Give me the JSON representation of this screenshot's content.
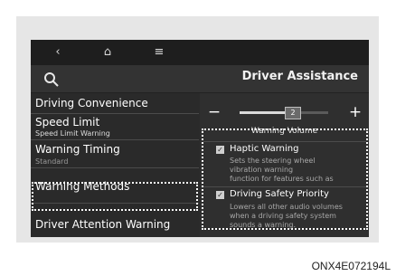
{
  "nav": {
    "back_icon": "‹",
    "home_icon": "⌂",
    "menu_icon": "≡"
  },
  "header": {
    "title": "Driver Assistance"
  },
  "sidebar": {
    "items": [
      {
        "label": "Driving Convenience",
        "sub": ""
      },
      {
        "label": "Speed Limit",
        "sub": "Speed Limit Warning"
      },
      {
        "label": "Warning Timing",
        "sub": "Standard"
      },
      {
        "label": "Warning Methods",
        "sub": ""
      },
      {
        "label": "Driver Attention Warning",
        "sub": ""
      }
    ]
  },
  "volume": {
    "minus": "−",
    "plus": "+",
    "value": "2",
    "label": "Warning Volume",
    "level_fraction": 0.6
  },
  "options": [
    {
      "title": "Haptic Warning",
      "checked": true,
      "desc": [
        "Sets the steering wheel",
        "vibration warning",
        "function for features such as"
      ]
    },
    {
      "title": "Driving Safety Priority",
      "checked": true,
      "desc": [
        "Lowers all other audio volumes",
        "when a driving safety system",
        "sounds a warning."
      ]
    }
  ],
  "code": "ONX4E072194L",
  "colors": {
    "screen_bg": "#2a2a2a",
    "panel_bg": "#e6e6e6",
    "accent": "#ffffff"
  }
}
